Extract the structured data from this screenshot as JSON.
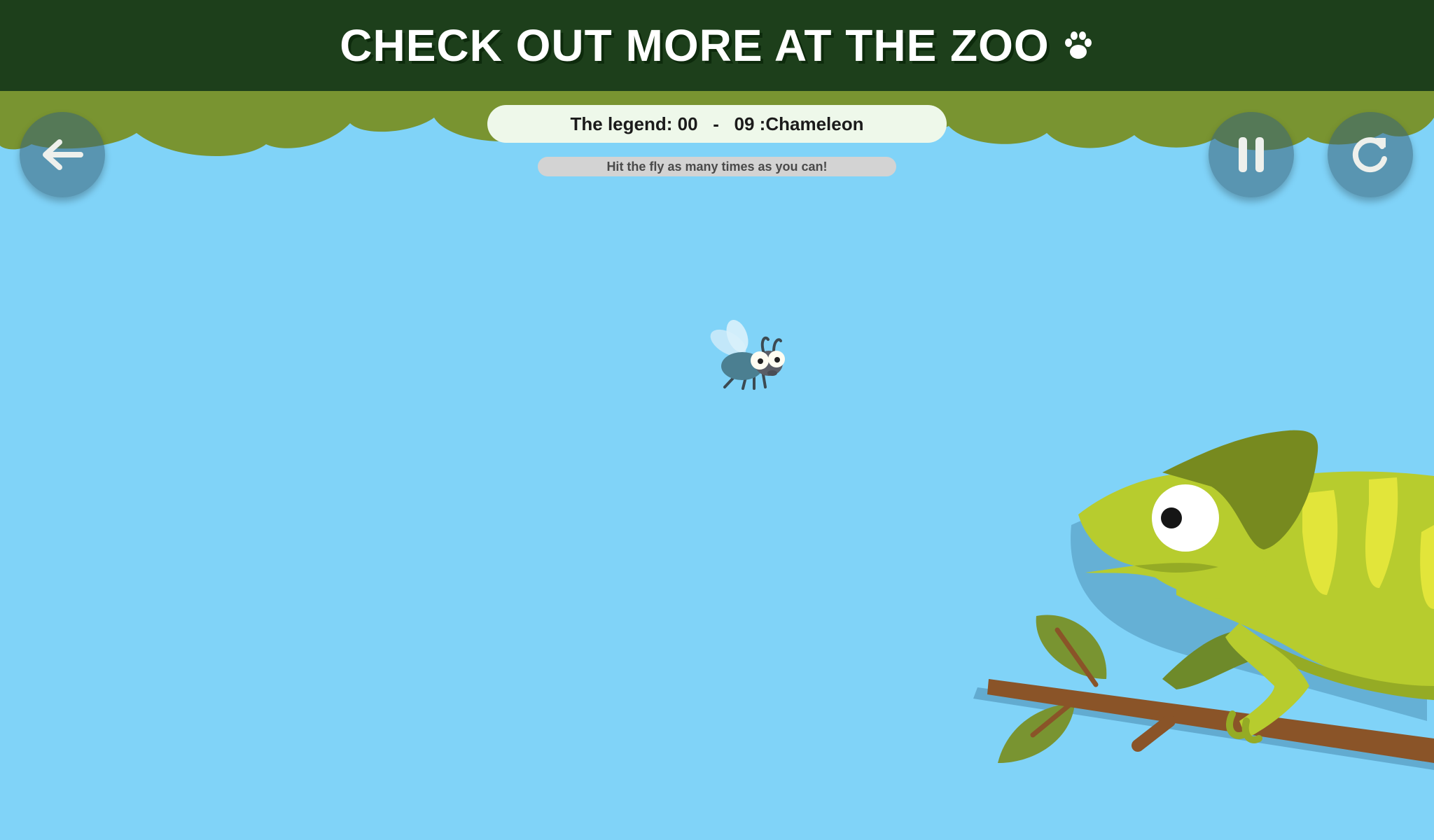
{
  "banner": {
    "title": "CHECK OUT MORE AT THE ZOO",
    "icon": "paw-icon",
    "background": "#1d3f1b"
  },
  "controls": {
    "back_icon": "back-arrow-icon",
    "pause_icon": "pause-icon",
    "restart_icon": "restart-icon"
  },
  "legend": {
    "label": "The legend: 00   -   09 :Chameleon"
  },
  "hint": {
    "text": "Hit the fly as many times as you can!"
  },
  "scene": {
    "sky_color": "#80d3f8",
    "canopy_color": "#799431",
    "characters": [
      "fly",
      "chameleon"
    ]
  }
}
